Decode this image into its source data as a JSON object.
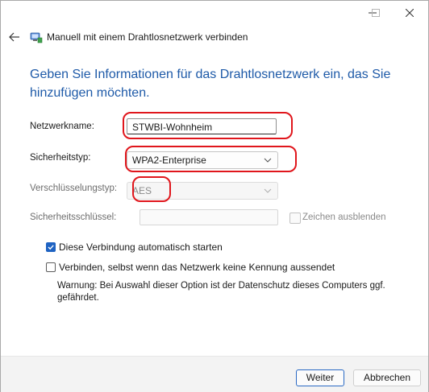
{
  "window": {
    "title": "Manuell mit einem Drahtlosnetzwerk verbinden",
    "caption_buttons": [
      "minimize-icon",
      "maximize-icon",
      "close-icon"
    ]
  },
  "heading": "Geben Sie Informationen für das Drahtlosnetzwerk ein, das Sie hinzufügen möchten.",
  "form": {
    "network_name_label": "Netzwerkname:",
    "network_name_value": "STWBI-Wohnheim",
    "security_type_label": "Sicherheitstyp:",
    "security_type_value": "WPA2-Enterprise",
    "encryption_type_label": "Verschlüsselungstyp:",
    "encryption_type_value": "AES",
    "security_key_label": "Sicherheitsschlüssel:",
    "security_key_value": "",
    "hide_chars_label": "Zeichen ausblenden",
    "hide_chars_checked": false
  },
  "options": {
    "auto_start_label": "Diese Verbindung automatisch starten",
    "auto_start_checked": true,
    "hidden_network_label": "Verbinden, selbst wenn das Netzwerk keine Kennung aussendet",
    "hidden_network_checked": false,
    "warning_text": "Warnung: Bei Auswahl dieser Option ist der Datenschutz dieses Computers ggf. gefährdet."
  },
  "buttons": {
    "next_label": "Weiter",
    "cancel_label": "Abbrechen"
  },
  "colors": {
    "heading": "#1e5aa8",
    "highlight": "#e0161c",
    "checkbox_accent": "#1f63c2"
  }
}
